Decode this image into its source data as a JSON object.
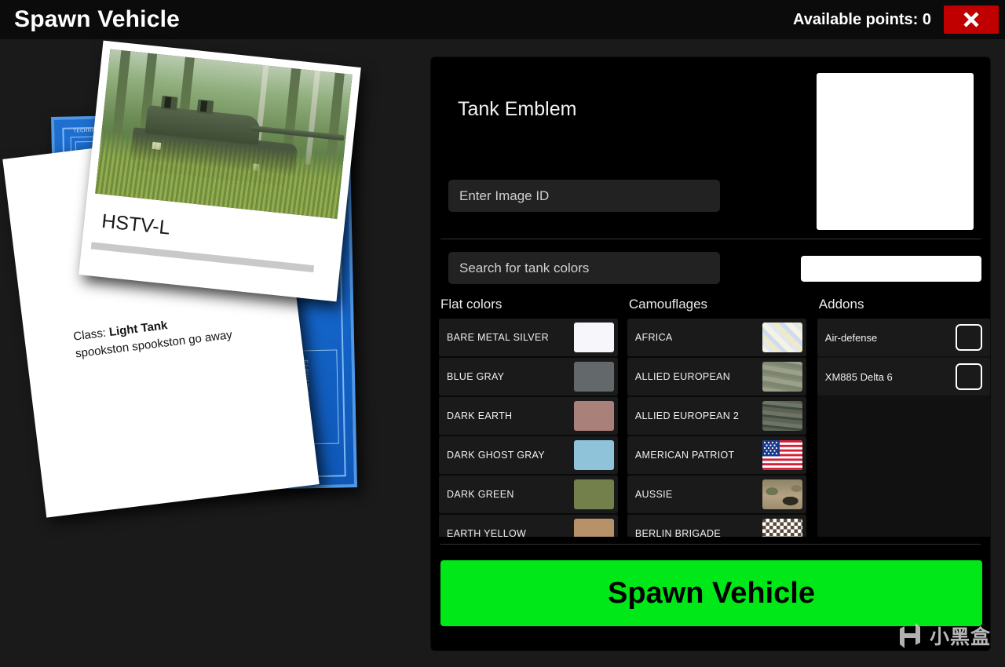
{
  "header": {
    "title": "Spawn Vehicle",
    "points_label": "Available points: 0",
    "close_icon": "close-x-icon"
  },
  "vehicle_card": {
    "name": "HSTV-L",
    "class_prefix": "Class: ",
    "class_value": "Light Tank",
    "description": "spookston spookston go away",
    "photo_alt": "hstv-l-tank-in-forest"
  },
  "emblem": {
    "title": "Tank Emblem",
    "input_value": "",
    "input_placeholder": "Enter Image ID",
    "preview_color": "#ffffff"
  },
  "search": {
    "value": "",
    "placeholder": "Search for tank colors"
  },
  "columns": {
    "flat": {
      "title": "Flat colors",
      "items": [
        {
          "label": "BARE METAL SILVER",
          "color": "#f7f6fa"
        },
        {
          "label": "BLUE GRAY",
          "color": "#63686a"
        },
        {
          "label": "DARK EARTH",
          "color": "#a9817a"
        },
        {
          "label": "DARK GHOST GRAY",
          "color": "#8ec3da"
        },
        {
          "label": "DARK GREEN",
          "color": "#74804c"
        },
        {
          "label": "EARTH YELLOW",
          "color": "#b79268"
        }
      ]
    },
    "camo": {
      "title": "Camouflages",
      "items": [
        {
          "label": "AFRICA",
          "pattern": "pat-africa"
        },
        {
          "label": "ALLIED EUROPEAN",
          "pattern": "pat-alliedeu"
        },
        {
          "label": "ALLIED EUROPEAN 2",
          "pattern": "pat-alliedeu2"
        },
        {
          "label": "AMERICAN PATRIOT",
          "pattern": "pat-flag"
        },
        {
          "label": "AUSSIE",
          "pattern": "pat-aussie"
        },
        {
          "label": "BERLIN BRIGADE",
          "pattern": "pat-berlin"
        }
      ]
    },
    "addons": {
      "title": "Addons",
      "items": [
        {
          "label": "Air-defense",
          "checked": false
        },
        {
          "label": "XM885 Delta 6",
          "checked": false
        }
      ]
    }
  },
  "spawn_button": {
    "label": "Spawn Vehicle",
    "color": "#00e817",
    "text_color": "#000000"
  },
  "watermark": {
    "text": "小黑盒",
    "logo": "xiaoheihe-h-logo"
  }
}
